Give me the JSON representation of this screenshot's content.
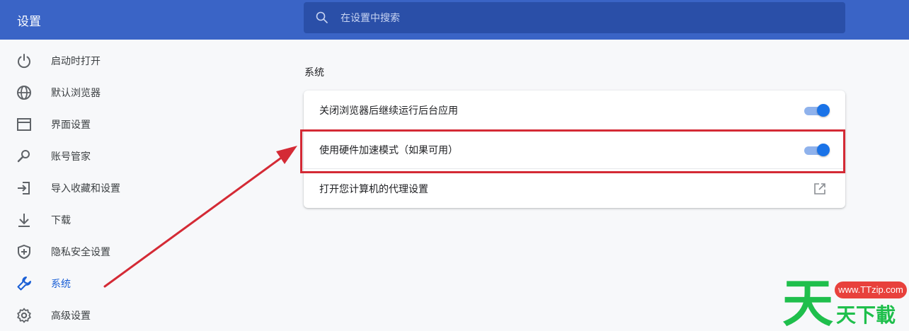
{
  "header": {
    "title": "设置",
    "search_placeholder": "在设置中搜索"
  },
  "sidebar": {
    "items": [
      {
        "label": "启动时打开",
        "icon": "power-icon"
      },
      {
        "label": "默认浏览器",
        "icon": "globe-icon"
      },
      {
        "label": "界面设置",
        "icon": "window-icon"
      },
      {
        "label": "账号管家",
        "icon": "key-icon"
      },
      {
        "label": "导入收藏和设置",
        "icon": "import-icon"
      },
      {
        "label": "下载",
        "icon": "download-icon"
      },
      {
        "label": "隐私安全设置",
        "icon": "shield-icon"
      },
      {
        "label": "系统",
        "icon": "wrench-icon",
        "active": true
      },
      {
        "label": "高级设置",
        "icon": "gear-icon"
      }
    ]
  },
  "main": {
    "section_title": "系统",
    "rows": [
      {
        "label": "关闭浏览器后继续运行后台应用",
        "control": "toggle",
        "on": true
      },
      {
        "label": "使用硬件加速模式（如果可用）",
        "control": "toggle",
        "on": true,
        "highlighted": true
      },
      {
        "label": "打开您计算机的代理设置",
        "control": "external-link-icon"
      }
    ]
  },
  "annotation": {
    "color": "#d42a35"
  },
  "watermark": {
    "url": "www.TTzip.com",
    "brand": "天天下載"
  },
  "colors": {
    "header": "#3a64c6",
    "search": "#2a4fa8",
    "accent": "#1a73e8",
    "active_nav": "#1a5fd6"
  }
}
